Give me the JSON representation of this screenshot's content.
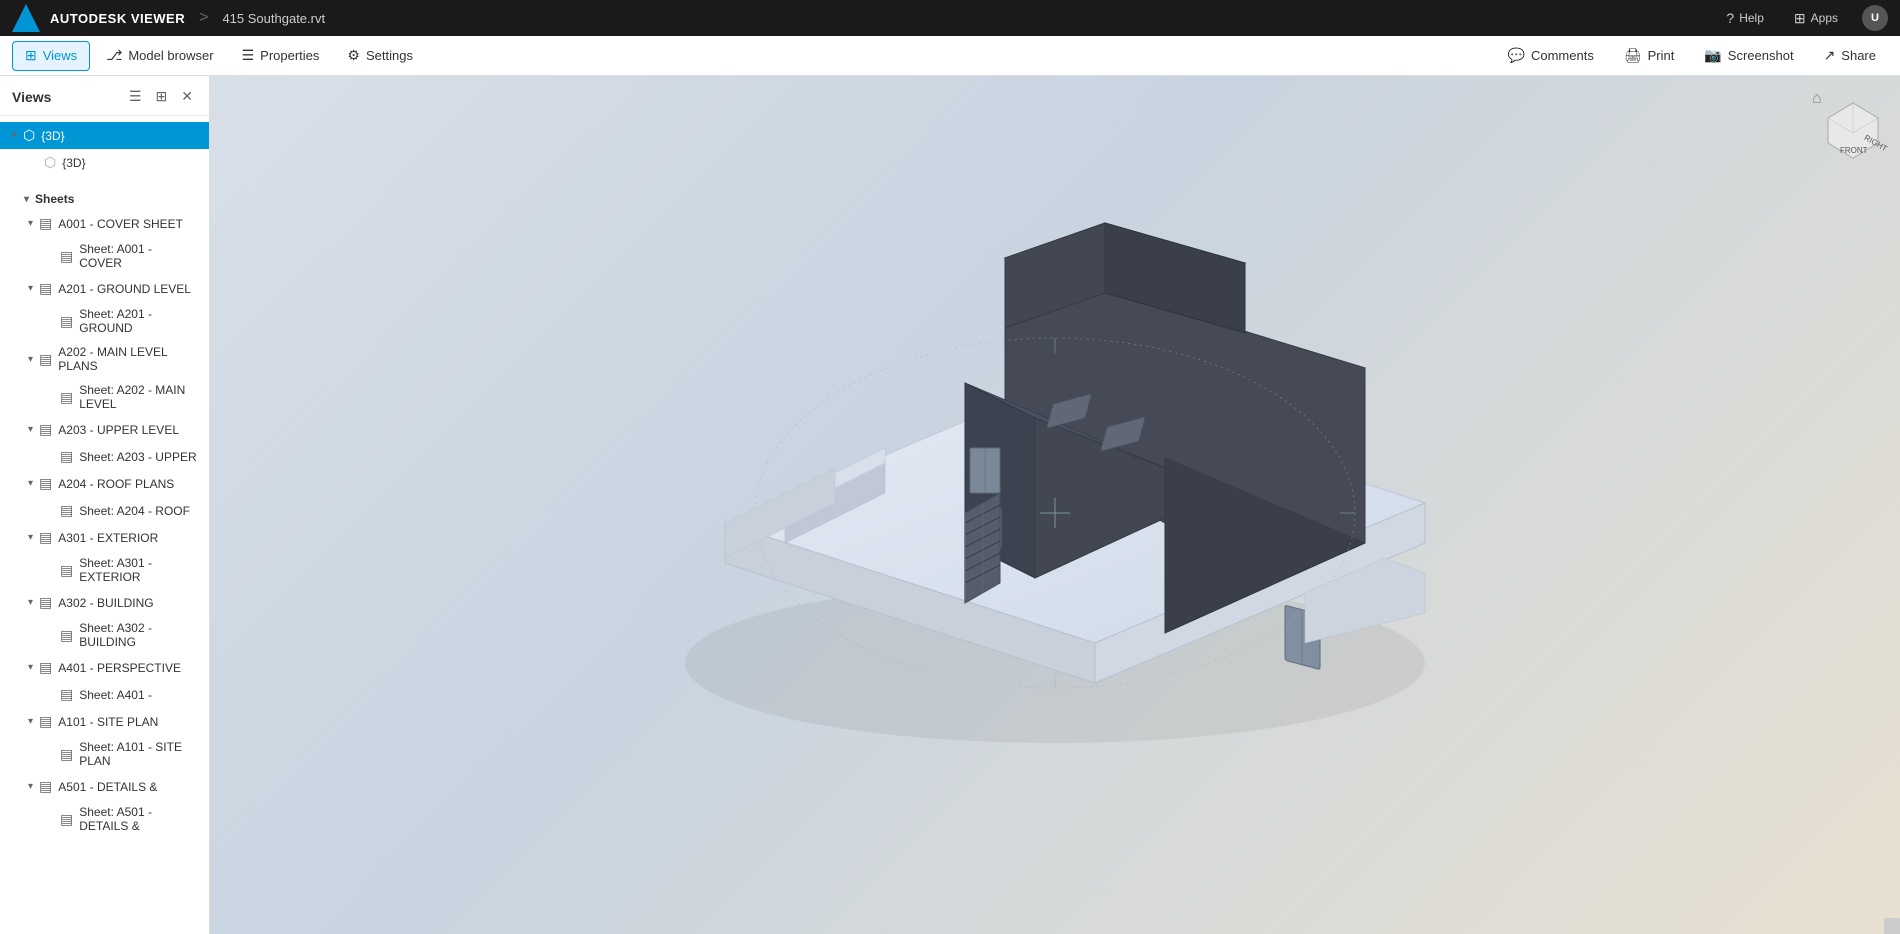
{
  "app": {
    "logo_text": "▲",
    "title": "AUTODESK VIEWER",
    "separator": ">",
    "file_name": "415 Southgate.rvt"
  },
  "header": {
    "help_label": "Help",
    "apps_label": "Apps",
    "user_initials": "U"
  },
  "toolbar": {
    "views_label": "Views",
    "model_browser_label": "Model browser",
    "properties_label": "Properties",
    "settings_label": "Settings",
    "comments_label": "Comments",
    "print_label": "Print",
    "screenshot_label": "Screenshot",
    "share_label": "Share"
  },
  "sidebar": {
    "title": "Views",
    "list_icon": "list",
    "grid_icon": "grid",
    "close_icon": "close",
    "tree": {
      "3d_section_label": "{3D}",
      "3d_child_label": "{3D}",
      "sheets_label": "Sheets",
      "sheets": [
        {
          "id": "A001",
          "label": "A001 - COVER SHEET",
          "child": "Sheet: A001 - COVER"
        },
        {
          "id": "A201",
          "label": "A201 - GROUND LEVEL",
          "child": "Sheet: A201 - GROUND"
        },
        {
          "id": "A202",
          "label": "A202 - MAIN LEVEL PLANS",
          "child": "Sheet: A202 - MAIN LEVEL"
        },
        {
          "id": "A203",
          "label": "A203 - UPPER LEVEL",
          "child": "Sheet: A203 - UPPER"
        },
        {
          "id": "A204",
          "label": "A204 - ROOF PLANS",
          "child": "Sheet: A204 - ROOF"
        },
        {
          "id": "A301",
          "label": "A301 - EXTERIOR",
          "child": "Sheet: A301 - EXTERIOR"
        },
        {
          "id": "A302",
          "label": "A302 - BUILDING",
          "child": "Sheet: A302 - BUILDING"
        },
        {
          "id": "A401",
          "label": "A401 - PERSPECTIVE",
          "child": "Sheet: A401 -"
        },
        {
          "id": "A101",
          "label": "A101 - SITE PLAN",
          "child": "Sheet: A101 - SITE PLAN"
        },
        {
          "id": "A501",
          "label": "A501 - DETAILS &",
          "child": "Sheet: A501 - DETAILS &"
        }
      ]
    }
  },
  "viewcube": {
    "front_label": "FRONT",
    "right_label": "RIGHT"
  },
  "colors": {
    "accent": "#0096d6",
    "bg_dark": "#1a1a1a",
    "sidebar_active": "#0096d6",
    "viewport_bg1": "#d8dfe8",
    "viewport_bg2": "#c8d4e0",
    "building_dark": "#3a3f4a",
    "platform_light": "#dde4ee"
  }
}
